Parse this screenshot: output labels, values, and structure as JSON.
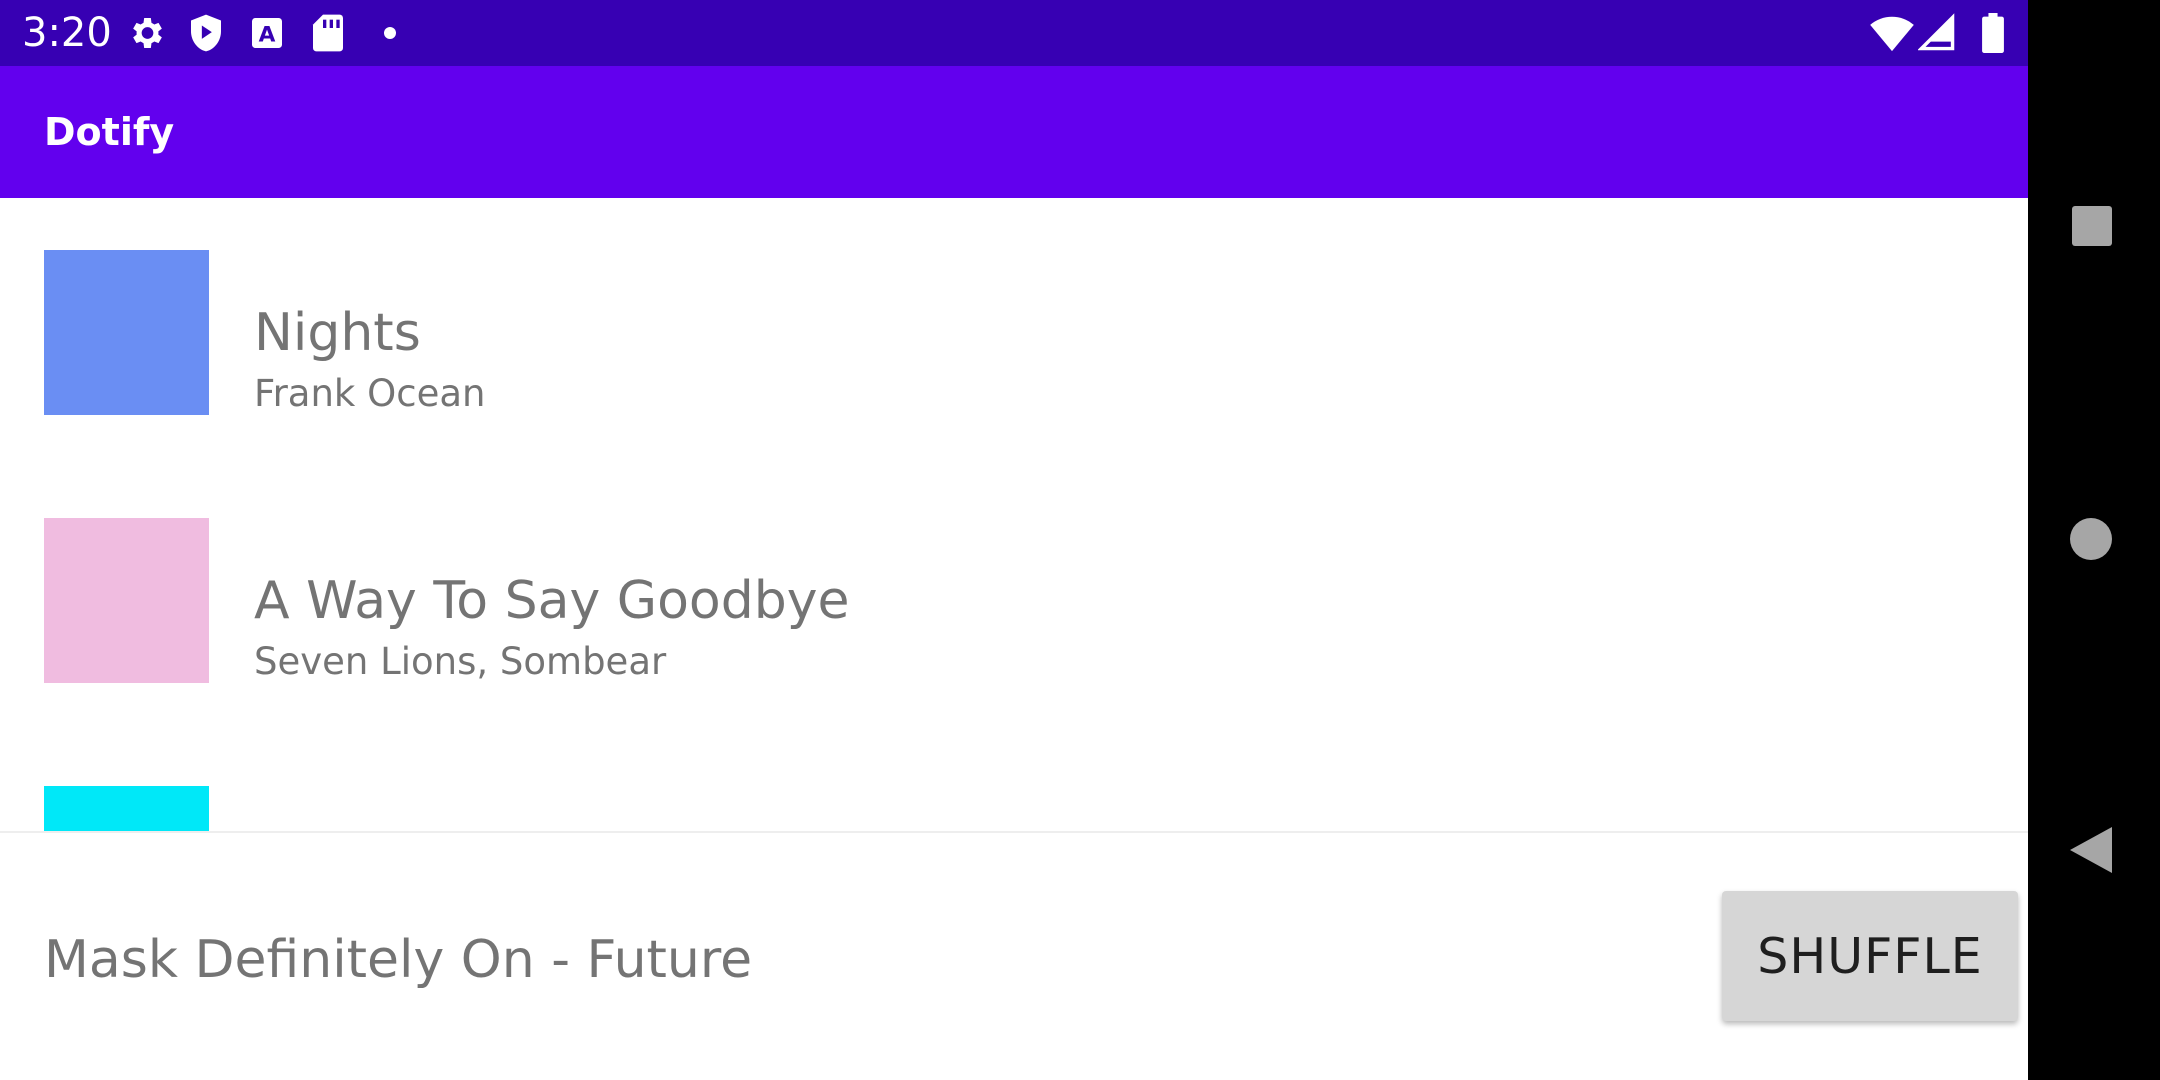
{
  "status_bar": {
    "time": "3:20",
    "left_icons": [
      "gear-icon",
      "shield-play-icon",
      "font-a-icon",
      "sd-card-icon",
      "dot-icon"
    ],
    "right_icons": [
      "wifi-icon",
      "cellular-signal-icon",
      "battery-icon"
    ],
    "background": "#3700B3"
  },
  "app_bar": {
    "title": "Dotify",
    "background": "#6200EE"
  },
  "songs": [
    {
      "title": "Nights",
      "artist": "Frank Ocean",
      "art_color": "#6A8EF3"
    },
    {
      "title": "A Way To Say Goodbye",
      "artist": "Seven Lions, Sombear",
      "art_color": "#F0BCE0"
    },
    {
      "title": "",
      "artist": "",
      "art_color": "#00E8F8"
    }
  ],
  "mini_player": {
    "now_playing": "Mask Definitely On - Future",
    "shuffle_label": "SHUFFLE"
  },
  "nav_bar": {
    "buttons": [
      "recents-square-icon",
      "home-circle-icon",
      "back-triangle-icon"
    ]
  }
}
